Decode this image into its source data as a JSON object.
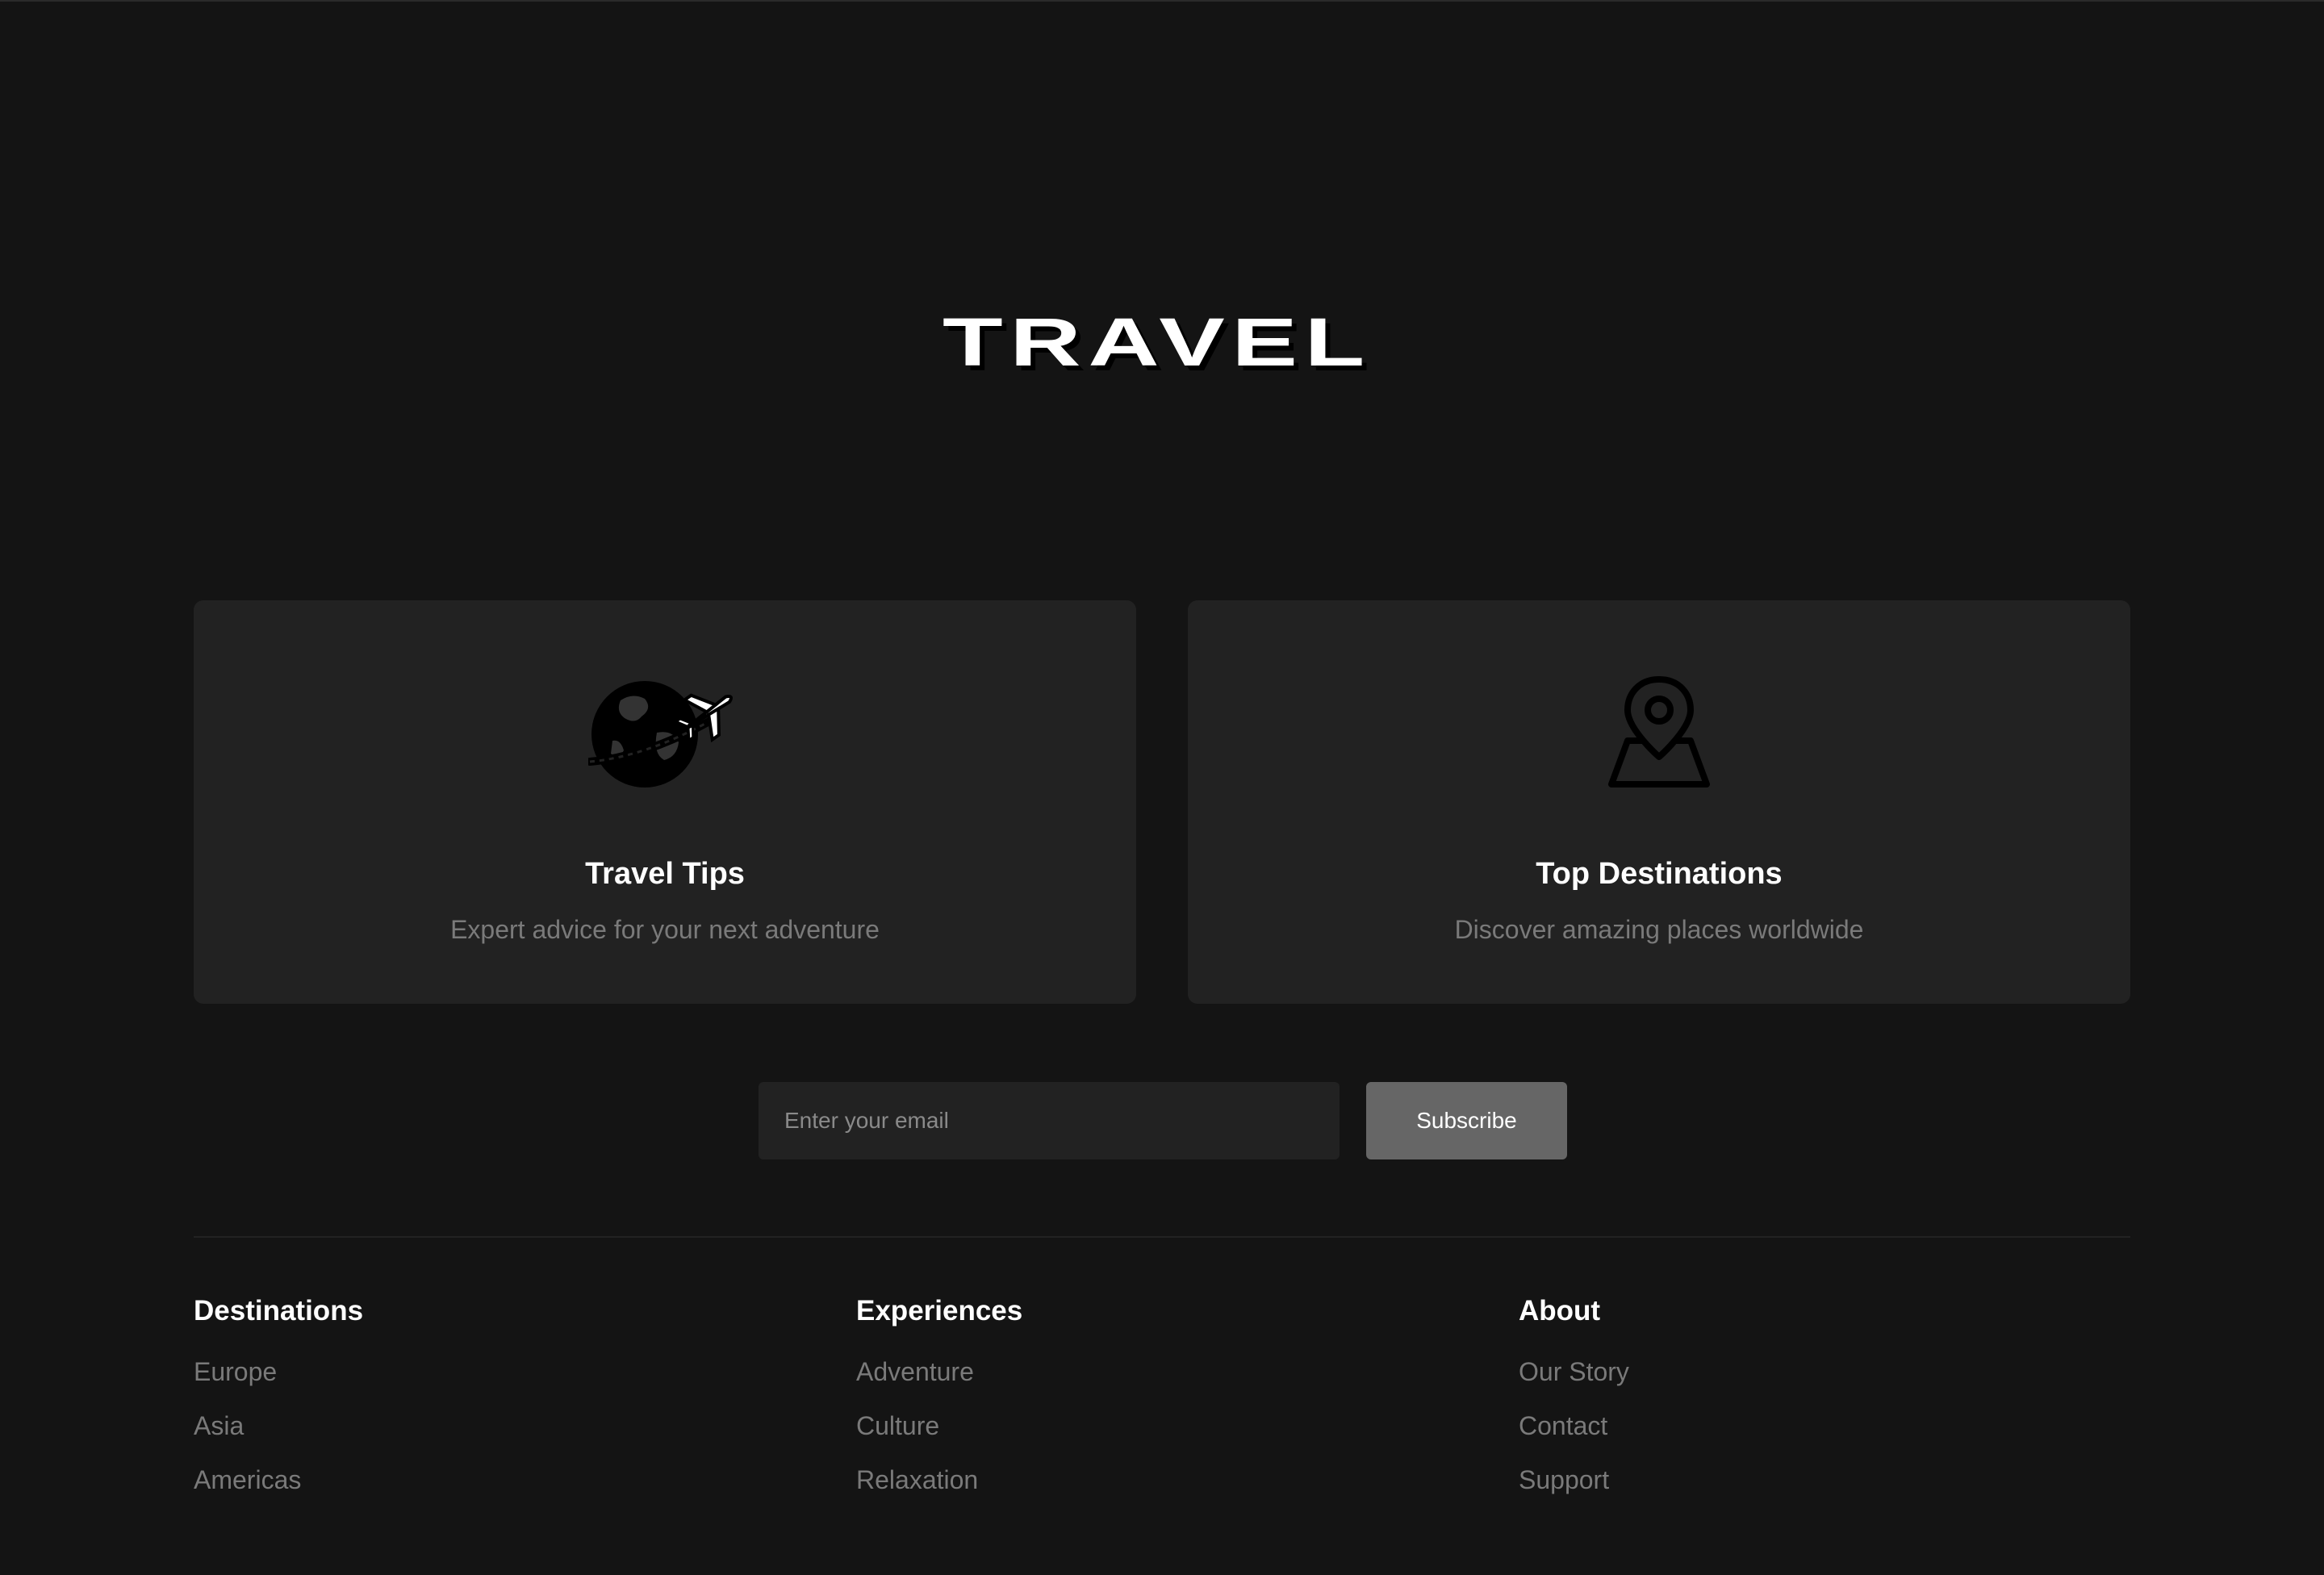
{
  "header": {
    "logo_text": "TRAVEL"
  },
  "cards": [
    {
      "icon": "globe-airplane-icon",
      "title": "Travel Tips",
      "description": "Expert advice for your next adventure"
    },
    {
      "icon": "map-pin-icon",
      "title": "Top Destinations",
      "description": "Discover amazing places worldwide"
    }
  ],
  "newsletter": {
    "placeholder": "Enter your email",
    "value": "",
    "button_label": "Subscribe"
  },
  "footer": {
    "columns": [
      {
        "heading": "Destinations",
        "links": [
          "Europe",
          "Asia",
          "Americas"
        ]
      },
      {
        "heading": "Experiences",
        "links": [
          "Adventure",
          "Culture",
          "Relaxation"
        ]
      },
      {
        "heading": "About",
        "links": [
          "Our Story",
          "Contact",
          "Support"
        ]
      }
    ]
  },
  "colors": {
    "background": "#141414",
    "card": "#222222",
    "button": "#666666",
    "text_primary": "#ffffff",
    "text_muted": "#7a7a7a"
  }
}
